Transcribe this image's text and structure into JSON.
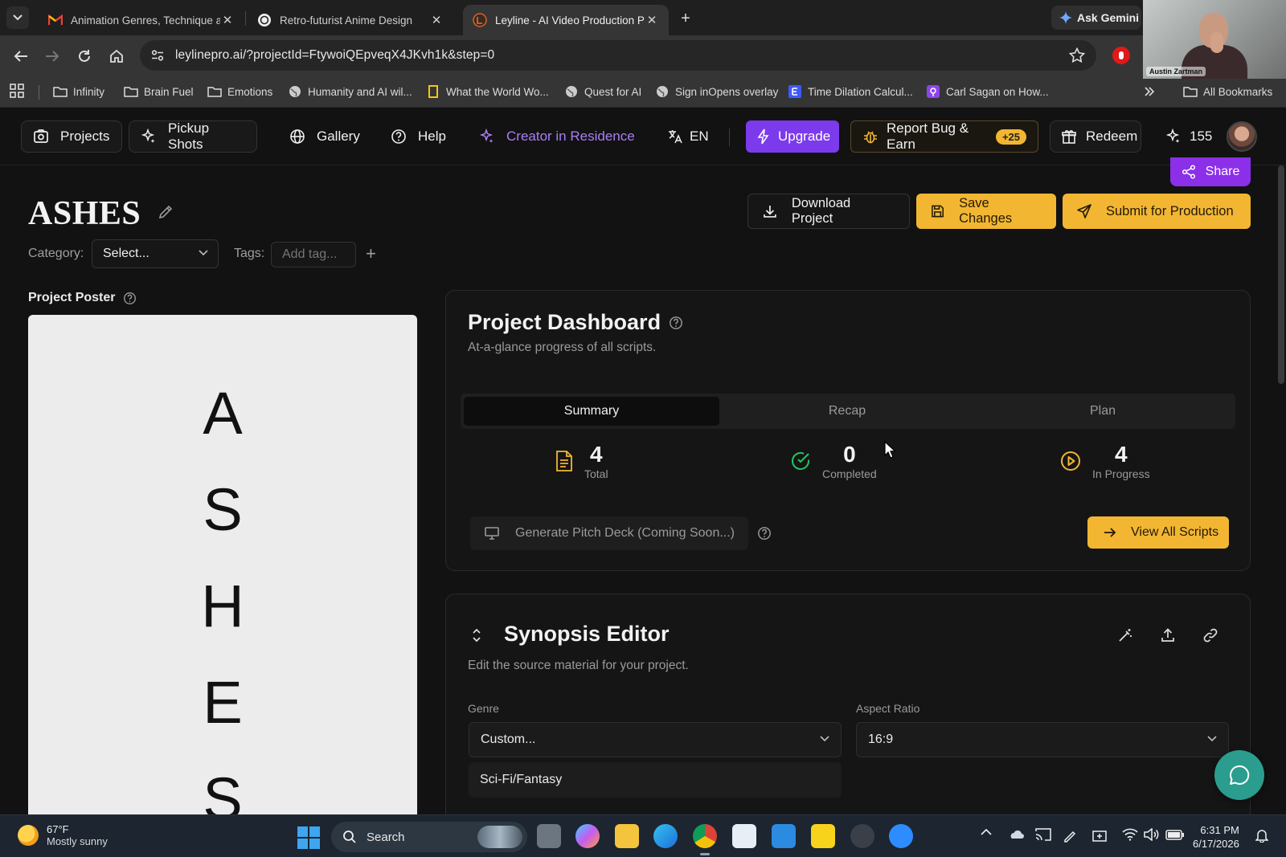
{
  "browser": {
    "tabs": [
      {
        "title": "Animation Genres, Technique an",
        "favicon": "gmail-icon",
        "active": false
      },
      {
        "title": "Retro-futurist Anime Design",
        "favicon": "chatgpt-icon",
        "active": false
      },
      {
        "title": "Leyline - AI Video Production P",
        "favicon": "leyline-icon",
        "active": true
      }
    ],
    "ask_gemini": "Ask Gemini",
    "url": "leylinepro.ai/?projectId=FtywoiQEpveqX4JKvh1k&step=0",
    "bookmarks": [
      {
        "label": "Infinity",
        "icon": "folder-icon"
      },
      {
        "label": "Brain Fuel",
        "icon": "folder-icon"
      },
      {
        "label": "Emotions",
        "icon": "folder-icon"
      },
      {
        "label": "Humanity and AI wil...",
        "icon": "globe-icon"
      },
      {
        "label": "What the World Wo...",
        "icon": "bookmark-yellow-icon"
      },
      {
        "label": "Quest for AI",
        "icon": "globe-icon"
      },
      {
        "label": "Sign inOpens overlay",
        "icon": "globe-icon"
      },
      {
        "label": "Time Dilation Calcul...",
        "icon": "e-icon"
      },
      {
        "label": "Carl Sagan on How...",
        "icon": "podcast-icon"
      }
    ],
    "all_bookmarks": "All Bookmarks",
    "webcam_name": "Austin Zartman"
  },
  "header": {
    "projects": "Projects",
    "pickup_shots": "Pickup Shots",
    "gallery": "Gallery",
    "help": "Help",
    "creator": "Creator in Residence",
    "lang": "EN",
    "upgrade": "Upgrade",
    "report": "Report Bug & Earn",
    "report_badge": "+25",
    "redeem": "Redeem",
    "credits": "155"
  },
  "project": {
    "share": "Share",
    "title": "ASHES",
    "download": "Download Project",
    "save": "Save Changes",
    "submit": "Submit for Production",
    "category_label": "Category:",
    "category_value": "Select...",
    "tags_label": "Tags:",
    "tags_placeholder": "Add tag...",
    "tag_add": "+",
    "poster_label": "Project Poster",
    "poster_letters": [
      "A",
      "S",
      "H",
      "E",
      "S"
    ]
  },
  "dashboard": {
    "title": "Project Dashboard",
    "subtitle": "At-a-glance progress of all scripts.",
    "tabs": [
      "Summary",
      "Recap",
      "Plan"
    ],
    "active_tab": "Summary",
    "stats": [
      {
        "value": "4",
        "label": "Total",
        "icon": "document-icon",
        "color": "#f2b632"
      },
      {
        "value": "0",
        "label": "Completed",
        "icon": "check-circle-icon",
        "color": "#22c55e"
      },
      {
        "value": "4",
        "label": "In Progress",
        "icon": "play-circle-icon",
        "color": "#f2b632"
      }
    ],
    "pitch": "Generate Pitch Deck (Coming Soon...)",
    "view_all": "View All Scripts"
  },
  "synopsis": {
    "title": "Synopsis Editor",
    "subtitle": "Edit the source material for your project.",
    "genre_label": "Genre",
    "genre_value": "Custom...",
    "aspect_label": "Aspect Ratio",
    "aspect_value": "16:9",
    "custom_genre": "Sci-Fi/Fantasy"
  },
  "taskbar": {
    "temp": "67°F",
    "condition": "Mostly sunny",
    "search": "Search",
    "time": "6:31 PM",
    "date": "6/17/2026"
  },
  "colors": {
    "accent_gold": "#f2b632",
    "accent_purple": "#7c3aed",
    "creator_purple": "#a87ef5",
    "success_green": "#22c55e",
    "chat_teal": "#2a9d8f"
  }
}
